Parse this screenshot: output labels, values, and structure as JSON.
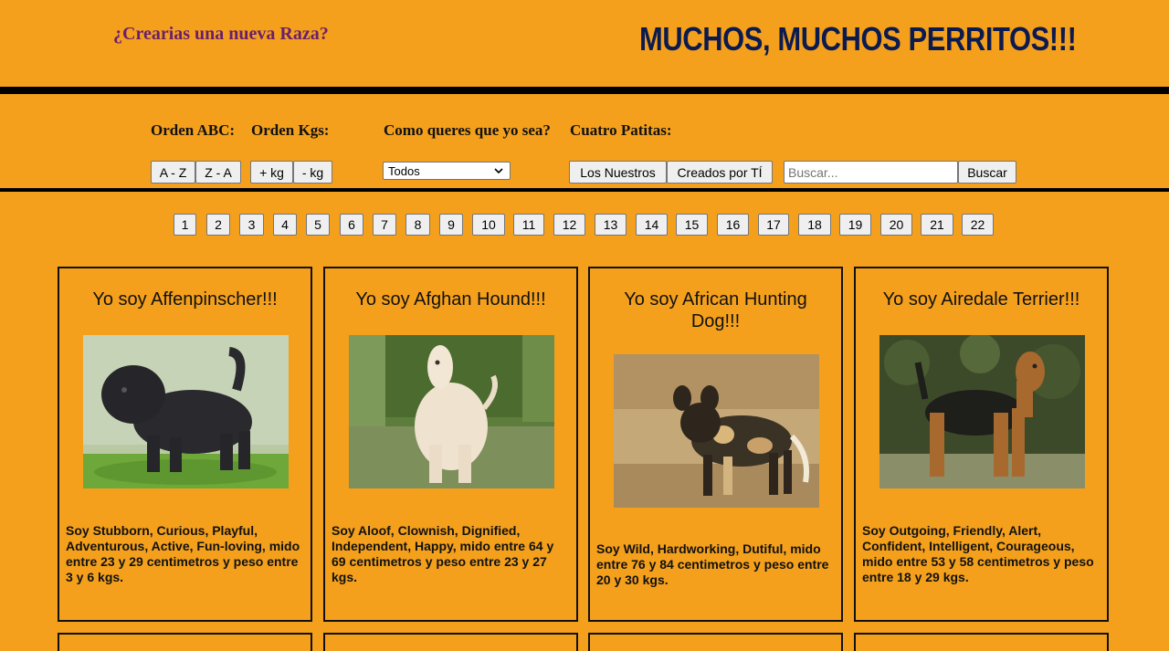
{
  "header": {
    "create_link": "¿Crearias una nueva Raza?",
    "title": "MUCHOS, MUCHOS PERRITOS!!!"
  },
  "filters": {
    "order_abc_label": "Orden ABC:",
    "order_kg_label": "Orden Kgs:",
    "temperament_label": "Como queres que yo sea?",
    "origin_label": "Cuatro Patitas:",
    "az": "A - Z",
    "za": "Z - A",
    "plus_kg": "+ kg",
    "minus_kg": "- kg",
    "temperament_selected": "Todos",
    "ours": "Los Nuestros",
    "created": "Creados por TÍ",
    "search_placeholder": "Buscar...",
    "search_button": "Buscar"
  },
  "pagination": [
    "1",
    "2",
    "3",
    "4",
    "5",
    "6",
    "7",
    "8",
    "9",
    "10",
    "11",
    "12",
    "13",
    "14",
    "15",
    "16",
    "17",
    "18",
    "19",
    "20",
    "21",
    "22"
  ],
  "cards": [
    {
      "title": "Yo soy Affenpinscher!!!",
      "description": "Soy Stubborn, Curious, Playful, Adventurous, Active, Fun-loving, mido entre 23 y 29 centimetros y peso entre 3 y 6 kgs.",
      "image": "black-shaggy-dog"
    },
    {
      "title": "Yo soy Afghan Hound!!!",
      "description": "Soy Aloof, Clownish, Dignified, Independent, Happy, mido entre 64 y 69 centimetros y peso entre 23 y 27 kgs.",
      "image": "cream-long-haired-dog"
    },
    {
      "title": "Yo soy African Hunting Dog!!!",
      "description": "Soy Wild, Hardworking, Dutiful, mido entre 76 y 84 centimetros y peso entre 20 y 30 kgs.",
      "image": "spotted-wild-dog"
    },
    {
      "title": "Yo soy Airedale Terrier!!!",
      "description": "Soy Outgoing, Friendly, Alert, Confident, Intelligent, Courageous, mido entre 53 y 58 centimetros y peso entre 18 y 29 kgs.",
      "image": "tan-terrier-dog"
    }
  ]
}
